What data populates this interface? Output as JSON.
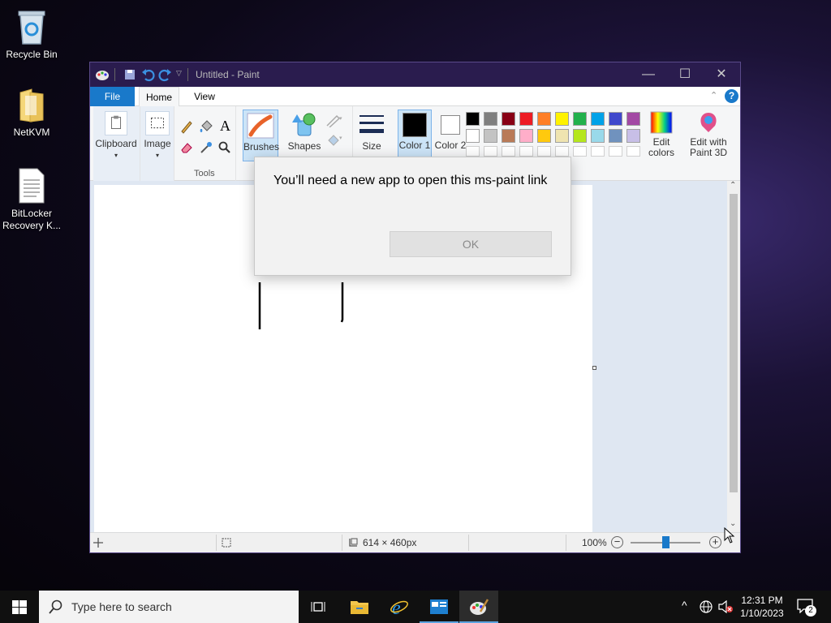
{
  "desktop": {
    "icons": [
      {
        "label": "Recycle Bin"
      },
      {
        "label": "NetKVM"
      },
      {
        "label": "BitLocker Recovery K..."
      }
    ]
  },
  "window": {
    "title": "Untitled - Paint",
    "tabs": {
      "file": "File",
      "home": "Home",
      "view": "View"
    },
    "ribbon": {
      "clipboard": "Clipboard",
      "image": "Image",
      "tools": "Tools",
      "brushes": "Brushes",
      "shapes": "Shapes",
      "size": "Size",
      "color1": "Color 1",
      "color2": "Color 2",
      "edit_colors": "Edit colors",
      "edit_paint3d": "Edit with Paint 3D",
      "text_tool": "A",
      "palette_row1": [
        "#000000",
        "#7f7f7f",
        "#880015",
        "#ed1c24",
        "#ff7f27",
        "#fff200",
        "#22b14c",
        "#00a2e8",
        "#3f48cc",
        "#a349a4"
      ],
      "palette_row2": [
        "#ffffff",
        "#c3c3c3",
        "#b97a57",
        "#ffaec9",
        "#ffc90e",
        "#efe4b0",
        "#b5e61d",
        "#99d9ea",
        "#7092be",
        "#c8bfe7"
      ]
    },
    "status": {
      "dimensions": "614 × 460px",
      "zoom": "100%"
    }
  },
  "dialog": {
    "message": "You’ll need a new app to open this ms-paint link",
    "ok_label": "OK"
  },
  "taskbar": {
    "search_placeholder": "Type here to search",
    "time": "12:31 PM",
    "date": "1/10/2023",
    "notifications": "2"
  }
}
